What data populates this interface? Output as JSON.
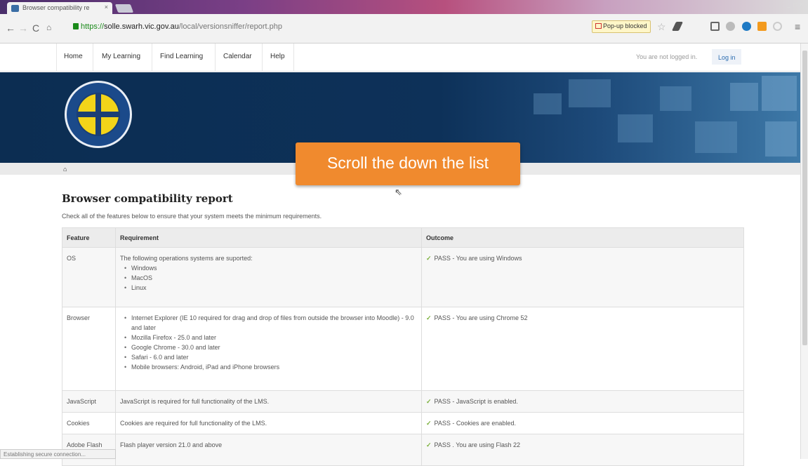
{
  "browser": {
    "tab_title": "Browser compatibility re",
    "tab_close": "×",
    "url_scheme": "https://",
    "url_host": "solle.swarh.vic.gov.au",
    "url_path": "/local/versionsniffer/report.php",
    "popup_blocked": "Pop-up blocked",
    "status_text": "Establishing secure connection...",
    "window_controls": "_ □ ×",
    "nav_icons": {
      "back": "back-arrow-icon",
      "forward": "forward-arrow-icon",
      "reload": "reload-icon",
      "home": "home-icon"
    },
    "toolbar_icons": [
      "star-icon",
      "extension-icon",
      "extension-icon",
      "extension-icon",
      "extension-icon",
      "extension-icon",
      "menu-icon"
    ]
  },
  "site_nav": {
    "items": [
      "Home",
      "My Learning",
      "Find Learning",
      "Calendar",
      "Help"
    ],
    "login_message": "You are not logged in.",
    "login_link": "Log in"
  },
  "banner": {
    "logo": "south-west-alliance-logo"
  },
  "breadcrumb": {
    "icon": "home-icon"
  },
  "callout": {
    "text": "Scroll the down the list"
  },
  "page": {
    "title": "Browser compatibility report",
    "intro": "Check all of the features below to ensure that your system meets the minimum requirements."
  },
  "table": {
    "headers": [
      "Feature",
      "Requirement",
      "Outcome"
    ],
    "rows": [
      {
        "feature": "OS",
        "requirement": "The following operations systems are suported:",
        "bullets": [
          "Windows",
          "MacOS",
          "Linux"
        ],
        "outcome": "PASS - You are using Windows"
      },
      {
        "feature": "Browser",
        "requirement": "",
        "bullets": [
          "Internet Explorer (IE 10 required for drag and drop of files from outside the browser into Moodle) - 9.0 and later",
          "Mozilla Firefox - 25.0 and later",
          "Google Chrome - 30.0 and later",
          "Safari - 6.0 and later",
          "Mobile browsers: Android, iPad and iPhone browsers"
        ],
        "outcome": "PASS - You are using Chrome 52"
      },
      {
        "feature": "JavaScript",
        "requirement": "JavaScript is required for full functionality of the LMS.",
        "bullets": [],
        "outcome": "PASS - JavaScript is enabled."
      },
      {
        "feature": "Cookies",
        "requirement": "Cookies are required for full functionality of the LMS.",
        "bullets": [],
        "outcome": "PASS - Cookies are enabled."
      },
      {
        "feature": "Adobe Flash player",
        "requirement": "Flash player version 21.0 and above",
        "bullets": [],
        "outcome": "PASS . You are using Flash 22"
      }
    ]
  },
  "colors": {
    "banner": "#0d3159",
    "callout": "#f08a2e",
    "pass_check": "#7ab03a",
    "link": "#2b6cb0"
  }
}
